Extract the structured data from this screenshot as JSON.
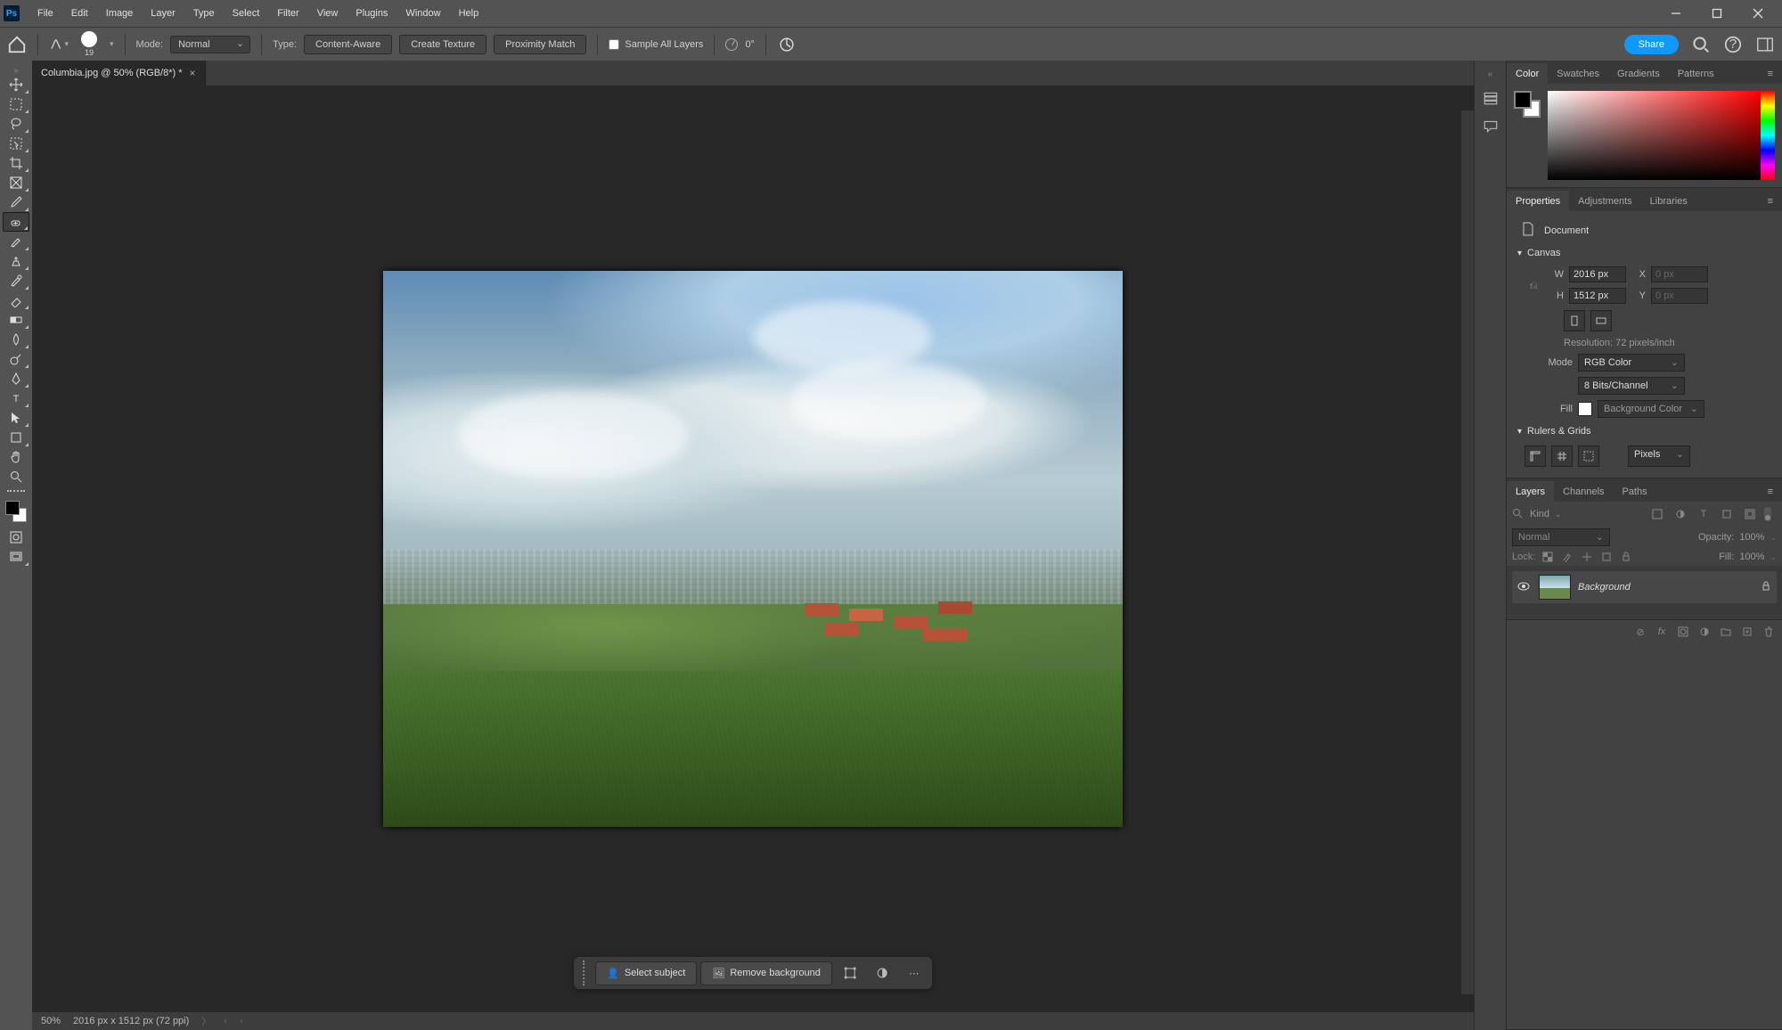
{
  "menu": {
    "items": [
      "File",
      "Edit",
      "Image",
      "Layer",
      "Type",
      "Select",
      "Filter",
      "View",
      "Plugins",
      "Window",
      "Help"
    ]
  },
  "options": {
    "brush_size": "19",
    "mode_label": "Mode:",
    "mode_value": "Normal",
    "type_label": "Type:",
    "type_buttons": [
      "Content-Aware",
      "Create Texture",
      "Proximity Match"
    ],
    "sample_all": "Sample All Layers",
    "angle_value": "0°",
    "share": "Share"
  },
  "document": {
    "tab_title": "Columbia.jpg @ 50% (RGB/8*) *",
    "zoom": "50%",
    "status": "2016 px x 1512 px (72 ppi)"
  },
  "context_bar": {
    "select_subject": "Select subject",
    "remove_bg": "Remove background"
  },
  "panels": {
    "color_tabs": [
      "Color",
      "Swatches",
      "Gradients",
      "Patterns"
    ],
    "props_tabs": [
      "Properties",
      "Adjustments",
      "Libraries"
    ],
    "doc_label": "Document",
    "canvas_label": "Canvas",
    "W_label": "W",
    "H_label": "H",
    "X_label": "X",
    "Y_label": "Y",
    "W": "2016 px",
    "H": "1512 px",
    "X": "0 px",
    "Y": "0 px",
    "resolution": "Resolution: 72 pixels/inch",
    "mode_label": "Mode",
    "mode_value": "RGB Color",
    "depth_value": "8 Bits/Channel",
    "fill_label": "Fill",
    "fill_value": "Background Color",
    "rulers_label": "Rulers & Grids",
    "units": "Pixels",
    "layers_tabs": [
      "Layers",
      "Channels",
      "Paths"
    ],
    "kind_placeholder": "Kind",
    "blend_mode": "Normal",
    "opacity_label": "Opacity:",
    "opacity_value": "100%",
    "lock_label": "Lock:",
    "fill_pct_label": "Fill:",
    "fill_pct_value": "100%",
    "layer_name": "Background"
  }
}
